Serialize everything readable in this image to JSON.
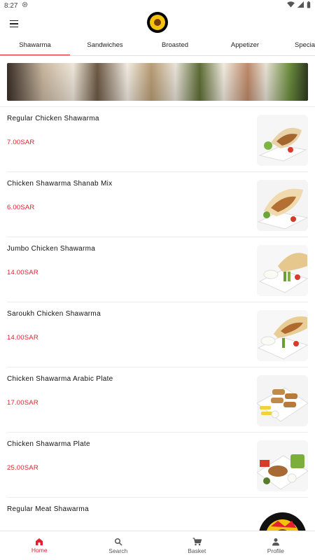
{
  "status": {
    "time": "8:27"
  },
  "tabs": [
    {
      "label": "Shawarma"
    },
    {
      "label": "Sandwiches"
    },
    {
      "label": "Broasted"
    },
    {
      "label": "Appetizer"
    },
    {
      "label": "Special"
    }
  ],
  "items": [
    {
      "name": "Regular Chicken Shawarma",
      "price": "7.00SAR"
    },
    {
      "name": "Chicken Shawarma Shanab Mix",
      "price": "6.00SAR"
    },
    {
      "name": "Jumbo Chicken Shawarma",
      "price": "14.00SAR"
    },
    {
      "name": "Saroukh Chicken Shawarma",
      "price": "14.00SAR"
    },
    {
      "name": "Chicken Shawarma Arabic Plate",
      "price": "17.00SAR"
    },
    {
      "name": "Chicken Shawarma Plate",
      "price": "25.00SAR"
    },
    {
      "name": "Regular Meat Shawarma",
      "price": ""
    }
  ],
  "nav": {
    "home": "Home",
    "search": "Search",
    "basket": "Basket",
    "profile": "Profile"
  },
  "colors": {
    "accent": "#e3202e"
  }
}
